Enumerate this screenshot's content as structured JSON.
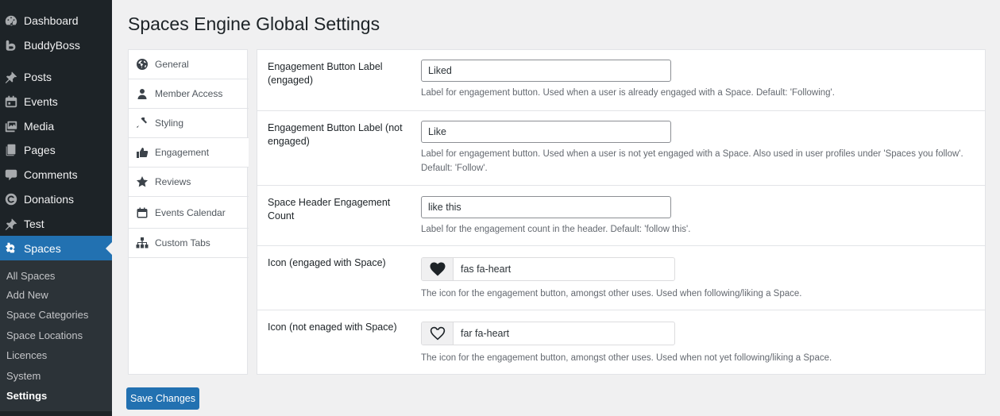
{
  "admin_menu": {
    "items": [
      {
        "label": "Dashboard",
        "icon": "dashboard-icon"
      },
      {
        "label": "BuddyBoss",
        "icon": "buddyboss-icon"
      },
      {
        "label": "Posts",
        "icon": "pushpin-icon"
      },
      {
        "label": "Events",
        "icon": "calendar-icon"
      },
      {
        "label": "Media",
        "icon": "media-icon"
      },
      {
        "label": "Pages",
        "icon": "pages-icon"
      },
      {
        "label": "Comments",
        "icon": "comment-icon"
      },
      {
        "label": "Donations",
        "icon": "donation-icon"
      },
      {
        "label": "Test",
        "icon": "pushpin-icon"
      },
      {
        "label": "Spaces",
        "icon": "spaces-icon"
      }
    ],
    "submenu": [
      "All Spaces",
      "Add New",
      "Space Categories",
      "Space Locations",
      "Licences",
      "System",
      "Settings"
    ]
  },
  "page": {
    "title": "Spaces Engine Global Settings"
  },
  "tabs": [
    {
      "label": "General",
      "icon": "globe-icon"
    },
    {
      "label": "Member Access",
      "icon": "user-icon"
    },
    {
      "label": "Styling",
      "icon": "brush-icon"
    },
    {
      "label": "Engagement",
      "icon": "thumbs-up-icon"
    },
    {
      "label": "Reviews",
      "icon": "star-icon"
    },
    {
      "label": "Events Calendar",
      "icon": "calendar-icon"
    },
    {
      "label": "Custom Tabs",
      "icon": "sitemap-icon"
    }
  ],
  "settings": {
    "engaged_label": {
      "label": "Engagement Button Label (engaged)",
      "value": "Liked",
      "desc": "Label for engagement button. Used when a user is already engaged with a Space. Default: 'Following'."
    },
    "not_engaged_label": {
      "label": "Engagement Button Label (not engaged)",
      "value": "Like",
      "desc": "Label for engagement button. Used when a user is not yet engaged with a Space. Also used in user profiles under 'Spaces you follow'. Default: 'Follow'."
    },
    "header_count": {
      "label": "Space Header Engagement Count",
      "value": "like this",
      "desc": "Label for the engagement count in the header. Default: 'follow this'."
    },
    "icon_engaged": {
      "label": "Icon (engaged with Space)",
      "value": "fas fa-heart",
      "desc": "The icon for the engagement button, amongst other uses. Used when following/liking a Space."
    },
    "icon_not_engaged": {
      "label": "Icon (not enaged with Space)",
      "value": "far fa-heart",
      "desc": "The icon for the engagement button, amongst other uses. Used when not yet following/liking a Space."
    }
  },
  "save_label": "Save Changes",
  "colors": {
    "accent": "#2271b1",
    "sidebar": "#1d2327"
  }
}
